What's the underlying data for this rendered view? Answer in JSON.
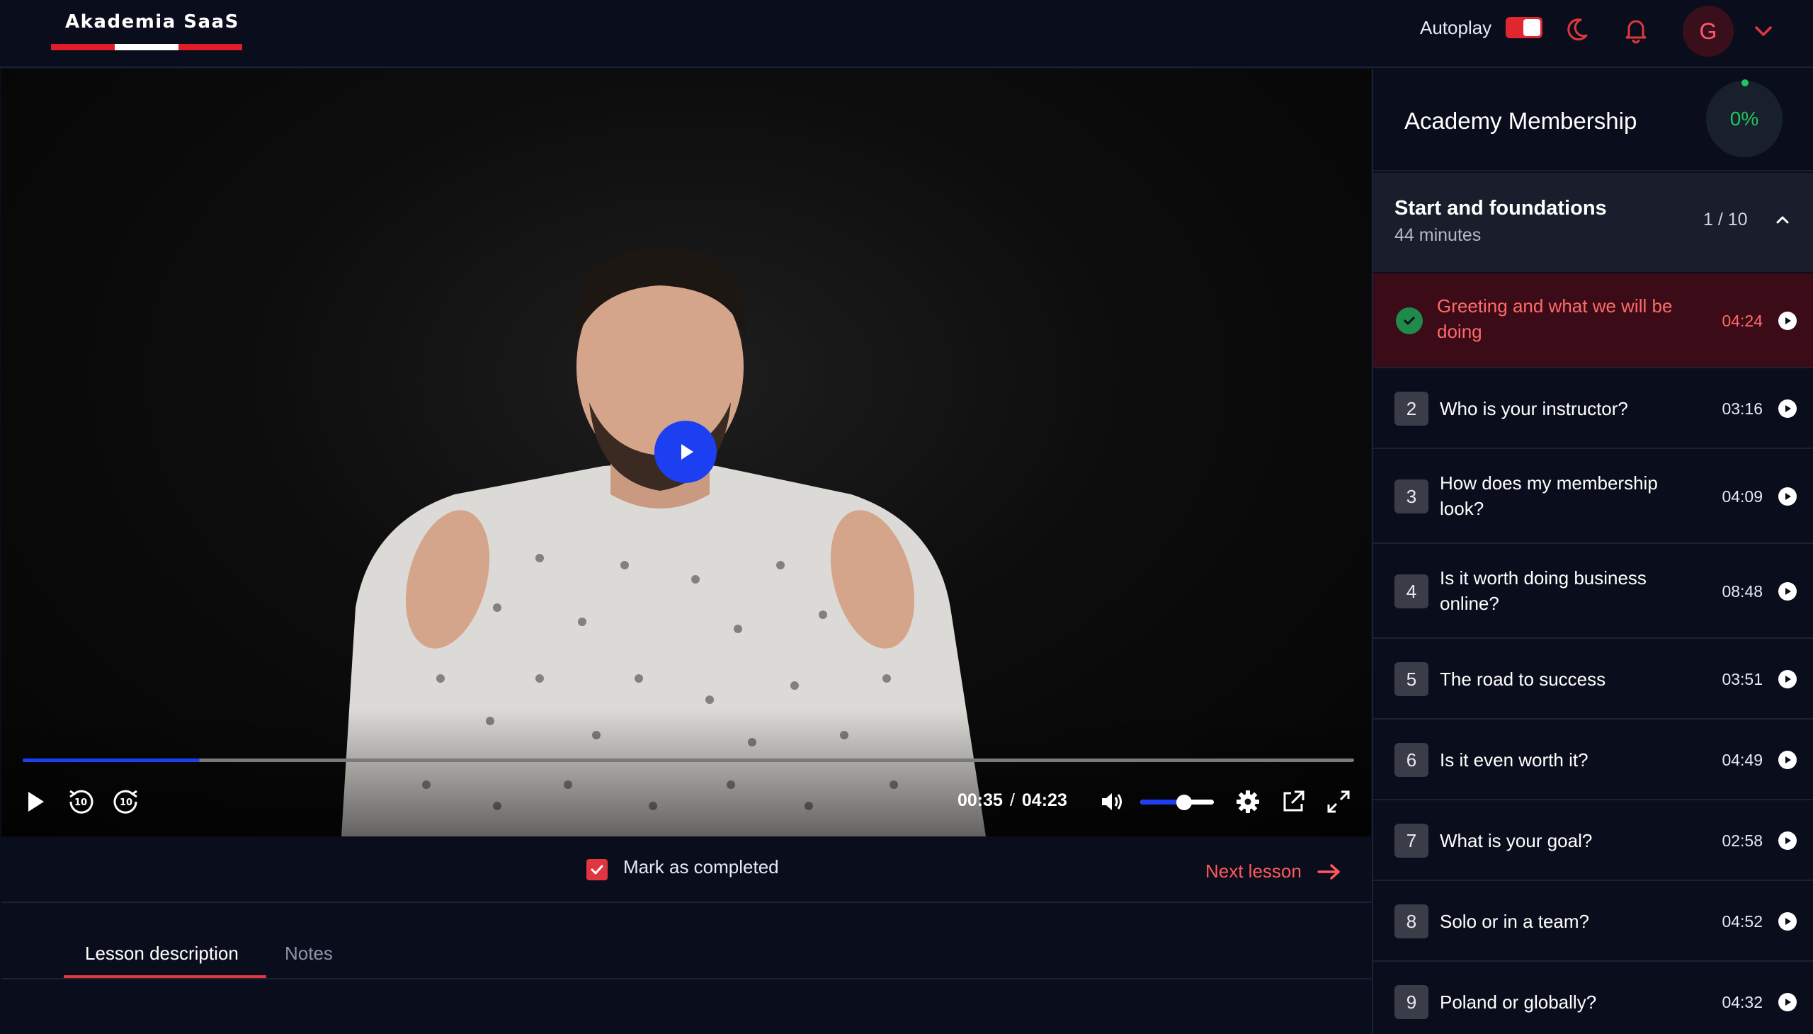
{
  "brand": {
    "name": "Akademia SaaS"
  },
  "header": {
    "autoplay_label": "Autoplay",
    "autoplay_on": true,
    "avatar_initial": "G"
  },
  "player": {
    "current_time": "00:35",
    "separator": "/",
    "duration": "04:23",
    "progress_fraction": 0.133,
    "volume_fraction": 0.6,
    "accent_color": "#1c3ff2"
  },
  "actions": {
    "mark_completed_label": "Mark as completed",
    "mark_completed_checked": true,
    "next_lesson_label": "Next lesson"
  },
  "tabs": [
    {
      "label": "Lesson description",
      "active": true
    },
    {
      "label": "Notes",
      "active": false
    }
  ],
  "sidebar": {
    "course_title": "Academy Membership",
    "progress_percent": "0%",
    "section": {
      "title": "Start and foundations",
      "duration": "44 minutes",
      "count": "1 / 10"
    },
    "lessons": [
      {
        "number": "1",
        "title": "Greeting and what we will be doing",
        "duration": "04:24",
        "completed": true,
        "active": true
      },
      {
        "number": "2",
        "title": "Who is your instructor?",
        "duration": "03:16"
      },
      {
        "number": "3",
        "title": "How does my membership look?",
        "duration": "04:09"
      },
      {
        "number": "4",
        "title": "Is it worth doing business online?",
        "duration": "08:48"
      },
      {
        "number": "5",
        "title": "The road to success",
        "duration": "03:51"
      },
      {
        "number": "6",
        "title": "Is it even worth it?",
        "duration": "04:49"
      },
      {
        "number": "7",
        "title": "What is your goal?",
        "duration": "02:58"
      },
      {
        "number": "8",
        "title": "Solo or in a team?",
        "duration": "04:52"
      },
      {
        "number": "9",
        "title": "Poland or globally?",
        "duration": "04:32"
      }
    ]
  }
}
